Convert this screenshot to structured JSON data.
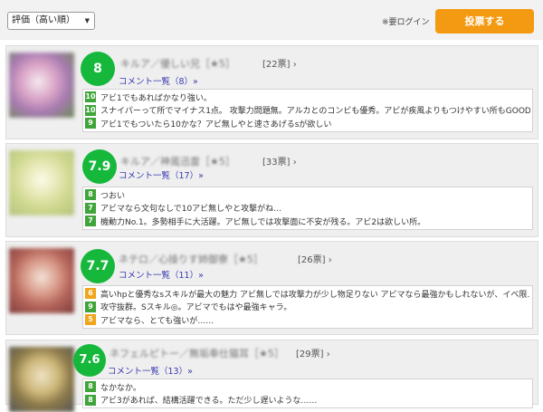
{
  "toolbar": {
    "sort_label": "評価（高い順）",
    "sort_arrow": "▼",
    "login_note": "※要ログイン",
    "post_label": "投票する"
  },
  "colors": {
    "score": "#16b83c",
    "post_button": "#f39a12",
    "badge_green": "#3fa43a",
    "badge_orange": "#f0a51a",
    "link": "#3a3ab0"
  },
  "items": [
    {
      "score": "8",
      "title": "キルア／優しい兄［★5］",
      "votes": "[22票] ›",
      "comment_link": "コメント一覧（8）»",
      "reviews": [
        {
          "score": "10",
          "text": "アビ1でもあればかなり強い。"
        },
        {
          "score": "10",
          "text": "スナイパーって所でマイナス1点。 攻撃力問題無。アルカとのコンビも優秀。アビが疾風よりもつけやすい所もGOOD…"
        },
        {
          "score": "9",
          "text": "アビ1でもついたら10かな？アビ無しやと速さあげるsが欲しい"
        }
      ]
    },
    {
      "score": "7.9",
      "title": "キルア／神風迅雷［★5］",
      "votes": "[33票] ›",
      "comment_link": "コメント一覧（17）»",
      "reviews": [
        {
          "score": "8",
          "text": "つおい"
        },
        {
          "score": "7",
          "text": "アビマなら文句なしで10アビ無しやと攻撃がね…"
        },
        {
          "score": "7",
          "text": "機動力No.1。多勢相手に大活躍。アビ無しでは攻撃面に不安が残る。アビ2は欲しい所。"
        }
      ]
    },
    {
      "score": "7.7",
      "title": "ネテロ／心操りす姉御寮［★5］",
      "votes": "[26票] ›",
      "comment_link": "コメント一覧（11）»",
      "reviews": [
        {
          "score": "6",
          "text": "高いhpと優秀なsスキルが最大の魅力 アビ無しでは攻撃力が少し物足りない アビマなら最強かもしれないが、イベ限…"
        },
        {
          "score": "9",
          "text": "攻守抜群。Sスキル◎。アビマでもはや最強キャラ。"
        },
        {
          "score": "5",
          "text": "アビマなら、とても強いが……"
        }
      ]
    },
    {
      "score": "7.6",
      "title": "ネフェルピトー／無垢奉仕猫耳［★5］",
      "votes": "[29票] ›",
      "comment_link": "コメント一覧（13）»",
      "reviews": [
        {
          "score": "8",
          "text": "なかなか。"
        },
        {
          "score": "8",
          "text": "アビ3があれば、結構活躍できる。ただ少し遅いような……"
        }
      ]
    }
  ]
}
